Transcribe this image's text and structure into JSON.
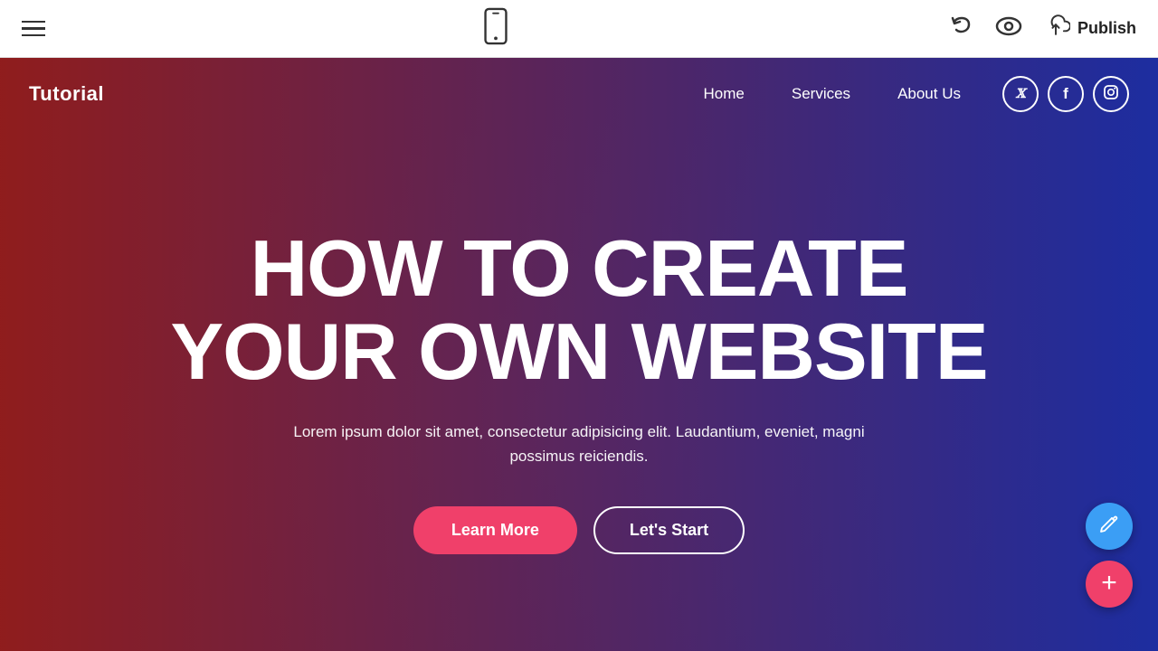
{
  "toolbar": {
    "hamburger_label": "menu",
    "undo_label": "undo",
    "preview_label": "preview",
    "publish_label": "Publish"
  },
  "site": {
    "logo": "Tutorial",
    "nav": {
      "items": [
        {
          "label": "Home",
          "href": "#"
        },
        {
          "label": "Services",
          "href": "#"
        },
        {
          "label": "About Us",
          "href": "#"
        }
      ]
    },
    "social": [
      {
        "name": "twitter",
        "symbol": "𝕏"
      },
      {
        "name": "facebook",
        "symbol": "f"
      },
      {
        "name": "instagram",
        "symbol": "📷"
      }
    ]
  },
  "hero": {
    "title_line1": "HOW TO CREATE",
    "title_line2": "YOUR OWN WEBSITE",
    "subtitle": "Lorem ipsum dolor sit amet, consectetur adipisicing elit. Laudantium, eveniet, magni possimus reiciendis.",
    "btn_learn_more": "Learn More",
    "btn_lets_start": "Let's Start"
  },
  "fabs": {
    "edit_icon": "pencil",
    "add_icon": "plus"
  }
}
